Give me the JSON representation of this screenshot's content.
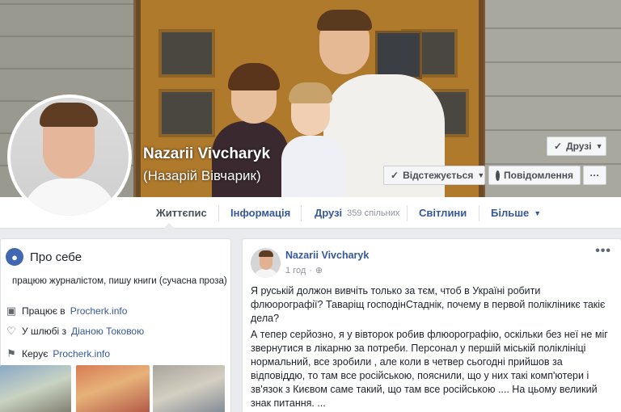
{
  "profile": {
    "name": "Nazarii Vivcharyk",
    "alt_name": "(Назарій Вівчарик)"
  },
  "actions": {
    "friends": "Друзі",
    "follow": "Відстежується",
    "message": "Повідомлення",
    "more": "···"
  },
  "nav": {
    "timeline": "Життєпис",
    "about": "Інформація",
    "friends": "Друзі",
    "friends_count": "359 спільних",
    "photos": "Світлини",
    "more": "Більше"
  },
  "about": {
    "title": "Про себе",
    "bio": "працюю журналістом, пишу книги (сучасна проза)",
    "work_prefix": "Працює в",
    "work_link": "Procherk.info",
    "marriage_prefix": "У шлюбі з",
    "marriage_link": "Діаною Токовою",
    "manages_prefix": "Керує",
    "manages_link": "Procherk.info"
  },
  "post": {
    "author": "Nazarii Vivcharyk",
    "time": "1 год",
    "options": "•••",
    "paragraph1": "Я руській должон вивчіть только за тєм, чтоб в Україні робити флюорографії? Таварiщ господінСтаднік, почему в первой полікліникє такіє дела?",
    "paragraph2": "А тепер серйозно, я у вівторок робив флюорографію, оскільки без неї не міг звернутися в лікарню за потреби. Персонал у першій міській поліклініці нормальний, все зробили , але коли в четвер сьогодні прийшов за відповіддю, то там все російською, пояснили, що у них такі комп'ютери і зв'язок з Києвом саме такий, що там все російською .... На цьому великий знак питання. ..."
  },
  "colors": {
    "link": "#365899",
    "accent": "#4267b2",
    "page_bg": "#e9ebee"
  }
}
